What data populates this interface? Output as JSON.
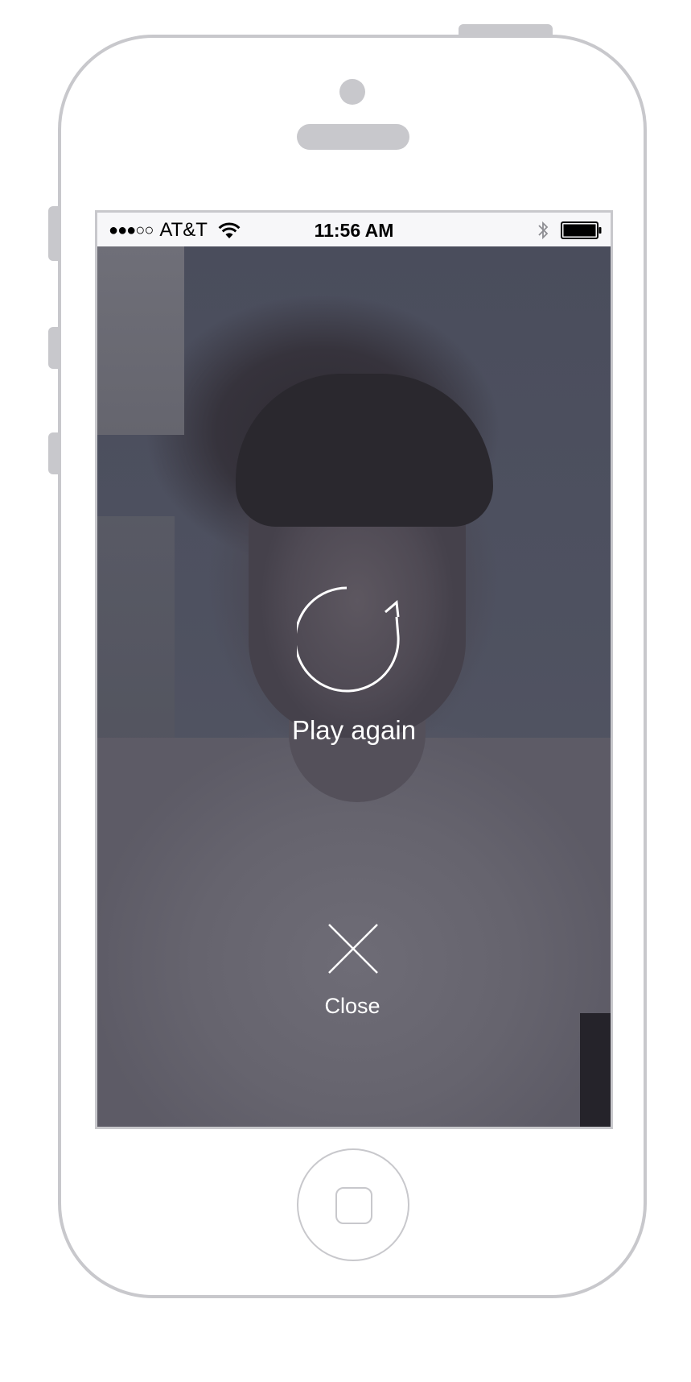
{
  "status_bar": {
    "signal": "●●●○○",
    "carrier": "AT&T",
    "time": "11:56 AM",
    "wifi_icon": "wifi-icon",
    "bluetooth_icon": "bluetooth-icon",
    "battery_icon": "battery-full-icon"
  },
  "player": {
    "replay_icon": "replay-icon",
    "replay_label": "Play again",
    "close_icon": "close-icon",
    "close_label": "Close"
  },
  "colors": {
    "device_outline": "#c8c8cc",
    "overlay_text": "#ffffff",
    "status_bar_bg": "#f7f7f9"
  }
}
